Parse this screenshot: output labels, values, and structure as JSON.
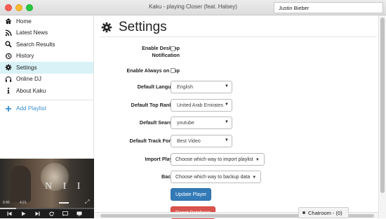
{
  "window": {
    "title": "Kaku - playing Closer (feat. Halsey)",
    "search_value": "Justin Bieber"
  },
  "sidebar": {
    "items": [
      {
        "label": "Home",
        "icon": "home-icon"
      },
      {
        "label": "Latest News",
        "icon": "rss-icon"
      },
      {
        "label": "Search Results",
        "icon": "search-icon"
      },
      {
        "label": "History",
        "icon": "history-icon"
      },
      {
        "label": "Settings",
        "icon": "gear-icon",
        "active": true
      },
      {
        "label": "Online DJ",
        "icon": "headphones-icon"
      },
      {
        "label": "About Kaku",
        "icon": "info-icon"
      }
    ],
    "add_playlist": "Add Playlist"
  },
  "player": {
    "current_time": "0:45",
    "duration": "4:21",
    "progress": 0.17
  },
  "settings": {
    "title": "Settings",
    "desktop_notification_label": "Enable Desktop Notification",
    "always_on_top_label": "Enable Always on Top",
    "language_label": "Default Language",
    "language_value": "English",
    "top_ranking_label": "Default Top Ranking",
    "top_ranking_value": "United Arab Emirates",
    "searcher_label": "Default Searcher",
    "searcher_value": "youtube",
    "track_format_label": "Default Track Format",
    "track_format_value": "Best Video",
    "import_label": "Import Playlist",
    "import_button": "Choose which way to import playlist",
    "backup_label": "Backup",
    "backup_button": "Choose which way to backup data",
    "update_button": "Update Player",
    "reset_button": "Reset Database"
  },
  "chatroom": {
    "label": "Chatroom - (0)"
  },
  "colors": {
    "active_nav": "#d8f2f7",
    "accent_link": "#3a8fd0",
    "primary": "#337ab7",
    "danger": "#d9534f"
  }
}
